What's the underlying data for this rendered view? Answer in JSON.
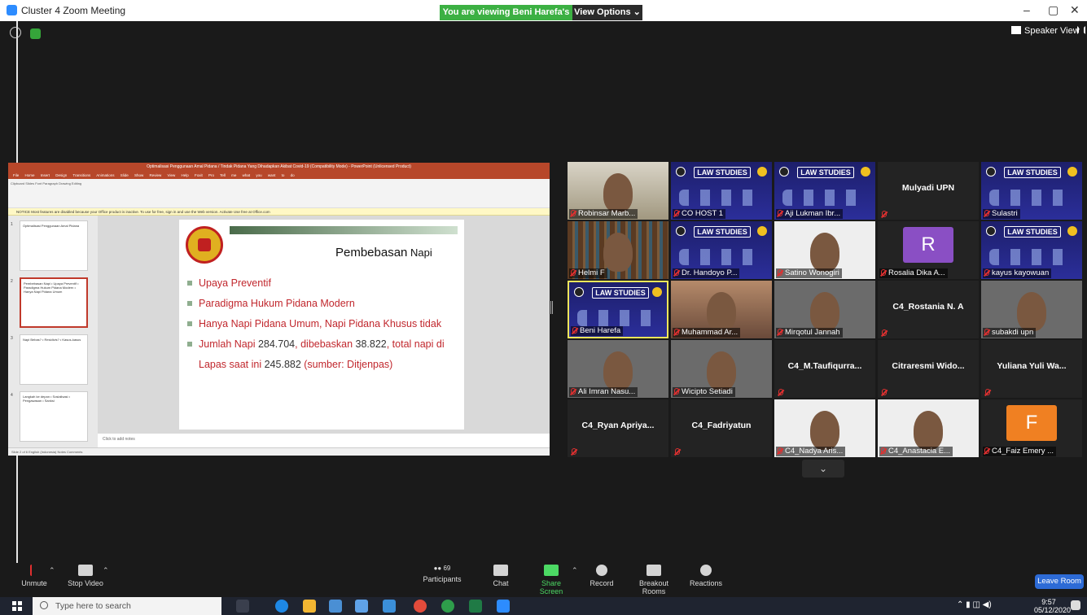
{
  "window": {
    "title": "Cluster 4  Zoom Meeting",
    "viewing_banner": "You are viewing Beni Harefa's screen",
    "view_options": "View Options ⌄",
    "minimize": "–",
    "restore": "▢",
    "close": "✕"
  },
  "header": {
    "speaker_view": "Speaker View"
  },
  "ppt": {
    "window_title": "Optimalisasi Penggunaan Amal Pidana / Tindak Pidana Yang Dihadapkan Akibat Covid-19 (Compatibility Mode) - PowerPoint (Unlicensed Product)",
    "tabs": "File Home Insert Design Transitions Animations Slide Show Review View Help Foxit Pro Tell me what you want to do",
    "ribbon": "Clipboard   Slides   Font   Paragraph   Drawing   Editing",
    "notice": "NOTICE  Most features are disabled because your Office product is inactive. To use for free, sign in and use the Web version.   Activate   Use free at Office.com",
    "thumbs": [
      {
        "num": "1",
        "text": "Optimalisasi Penggunaan Amal Pidana"
      },
      {
        "num": "2",
        "text": "Pembebasan Napi • Upaya Preventif • Paradigma Hukum Pidana Modern • Hanya Napi Pidana Umum"
      },
      {
        "num": "3",
        "text": "Napi Bebas? • Residivis? • Kasus-kasus"
      },
      {
        "num": "4",
        "text": "Langkah ke depan • Sosialisasi • Pengawasan • Sanksi"
      }
    ],
    "notes": "Click to add notes",
    "status": "Slide 2 of 6     English (Indonesia)                                                                                         Notes   Comments"
  },
  "slide": {
    "title": "Pembebasan",
    "title_small": " Napi",
    "bullets": [
      {
        "a": "Upaya Preventif",
        "b": "",
        "c": "",
        "d": "",
        "e": "",
        "f": ""
      },
      {
        "a": "Paradigma Hukum Pidana Modern",
        "b": "",
        "c": "",
        "d": "",
        "e": "",
        "f": ""
      },
      {
        "a": "Hanya Napi Pidana Umum, Napi Pidana Khusus tidak",
        "b": "",
        "c": "",
        "d": "",
        "e": "",
        "f": ""
      },
      {
        "a": "Jumlah Napi ",
        "b": "284.704",
        "c": ", dibebaskan ",
        "d": "38.822",
        "e": ", total napi di Lapas saat ini ",
        "f": "245.882"
      }
    ],
    "bullet4_tail": " (sumber: Ditjenpas)"
  },
  "gallery": [
    {
      "name": "Robinsar Marb...",
      "kind": "room"
    },
    {
      "name": "CO HOST 1",
      "kind": "law"
    },
    {
      "name": "Aji Lukman Ibr...",
      "kind": "law"
    },
    {
      "name": "Mulyadi UPN",
      "kind": "text"
    },
    {
      "name": "Sulastri",
      "kind": "law"
    },
    {
      "name": "Helmi F",
      "kind": "books"
    },
    {
      "name": "Dr. Handoyo P...",
      "kind": "law"
    },
    {
      "name": "Satino Wonogiri",
      "kind": "white"
    },
    {
      "name": "Rosalia Dika A...",
      "kind": "avatar-r",
      "initial": "R"
    },
    {
      "name": "kayus kayowuan",
      "kind": "law"
    },
    {
      "name": "Beni Harefa",
      "kind": "law",
      "active": true
    },
    {
      "name": "Muhammad Ar...",
      "kind": "warm"
    },
    {
      "name": "Mirqotul Jannah",
      "kind": "cam"
    },
    {
      "name": "C4_Rostania N. A",
      "kind": "text"
    },
    {
      "name": "subakdi upn",
      "kind": "cam"
    },
    {
      "name": "Ali Imran Nasu...",
      "kind": "cam"
    },
    {
      "name": "Wicipto Setiadi",
      "kind": "cam"
    },
    {
      "name": "C4_M.Taufiqurra...",
      "kind": "text"
    },
    {
      "name": "Citraresmi Wido...",
      "kind": "text"
    },
    {
      "name": "Yuliana Yuli Wa...",
      "kind": "text"
    },
    {
      "name": "C4_Ryan  Apriya...",
      "kind": "text"
    },
    {
      "name": "C4_Fadriyatun",
      "kind": "text"
    },
    {
      "name": "C4_Nadya Aris...",
      "kind": "white"
    },
    {
      "name": "C4_Anastacia E...",
      "kind": "white"
    },
    {
      "name": "C4_Faiz Emery ...",
      "kind": "avatar-f",
      "initial": "F"
    }
  ],
  "law_title": "LAW STUDIES",
  "toolbar": {
    "unmute": "Unmute",
    "stop_video": "Stop Video",
    "participants": "Participants",
    "participant_count": "69",
    "chat": "Chat",
    "share_screen": "Share Screen",
    "record": "Record",
    "breakout": "Breakout Rooms",
    "reactions": "Reactions",
    "leave": "Leave Room"
  },
  "taskbar": {
    "search_placeholder": "Type here to search",
    "time": "9:57",
    "date": "05/12/2020"
  },
  "colors": {
    "zoom_green": "#3cb043",
    "slide_red": "#c1272d",
    "leave_blue": "#2d6bd6",
    "ppt_red": "#b7472a"
  }
}
